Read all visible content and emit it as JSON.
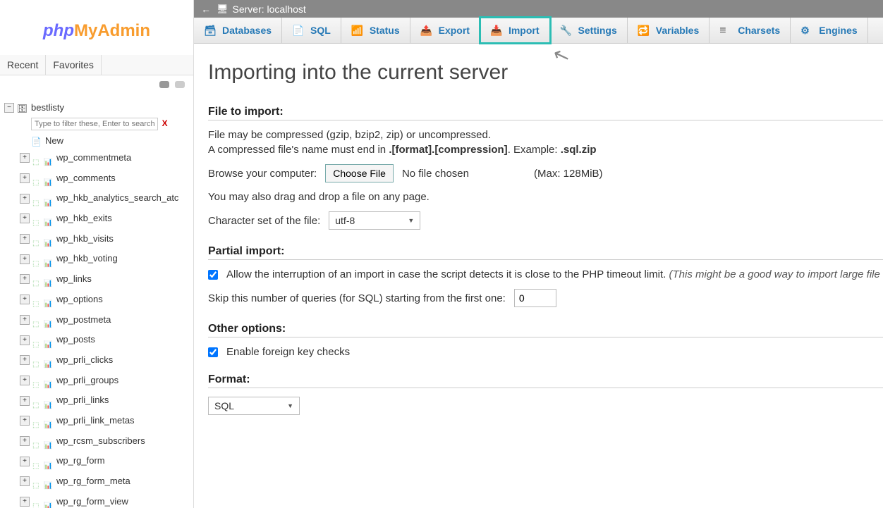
{
  "logo": {
    "php": "php",
    "my": "My",
    "admin": "Admin"
  },
  "sidebar_tabs": {
    "recent": "Recent",
    "favorites": "Favorites"
  },
  "tree": {
    "db": "bestlisty",
    "filter_placeholder": "Type to filter these, Enter to search all",
    "new_label": "New",
    "tables": [
      "wp_commentmeta",
      "wp_comments",
      "wp_hkb_analytics_search_atc",
      "wp_hkb_exits",
      "wp_hkb_visits",
      "wp_hkb_voting",
      "wp_links",
      "wp_options",
      "wp_postmeta",
      "wp_posts",
      "wp_prli_clicks",
      "wp_prli_groups",
      "wp_prli_links",
      "wp_prli_link_metas",
      "wp_rcsm_subscribers",
      "wp_rg_form",
      "wp_rg_form_meta",
      "wp_rg_form_view"
    ]
  },
  "topbar": {
    "server_label": "Server: localhost"
  },
  "tabs": {
    "databases": "Databases",
    "sql": "SQL",
    "status": "Status",
    "export": "Export",
    "import": "Import",
    "settings": "Settings",
    "variables": "Variables",
    "charsets": "Charsets",
    "engines": "Engines"
  },
  "page": {
    "title": "Importing into the current server",
    "file_to_import": "File to import:",
    "file_may": "File may be compressed (gzip, bzip2, zip) or uncompressed.",
    "compressed_prefix": "A compressed file's name must end in ",
    "compressed_bold": ".[format].[compression]",
    "compressed_mid": ". Example: ",
    "compressed_example": ".sql.zip",
    "browse_label": "Browse your computer:",
    "choose_file": "Choose File",
    "no_file": "No file chosen",
    "max": "(Max: 128MiB)",
    "drag_drop": "You may also drag and drop a file on any page.",
    "charset_label": "Character set of the file:",
    "charset_value": "utf-8",
    "partial_import": "Partial import:",
    "allow_interrupt": "Allow the interruption of an import in case the script detects it is close to the PHP timeout limit. ",
    "allow_interrupt_italic": "(This might be a good way to import large file",
    "skip_label": "Skip this number of queries (for SQL) starting from the first one:",
    "skip_value": "0",
    "other_options": "Other options:",
    "fk_checks": "Enable foreign key checks",
    "format": "Format:",
    "format_value": "SQL"
  }
}
